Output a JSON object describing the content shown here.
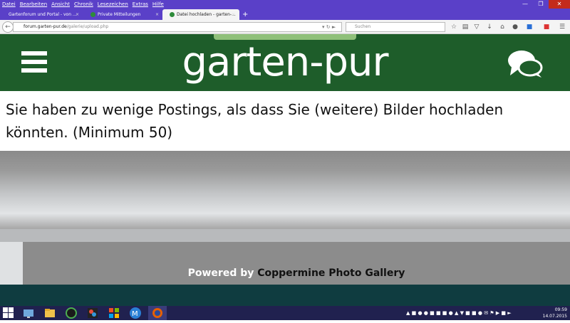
{
  "menu": [
    "Datei",
    "Bearbeiten",
    "Ansicht",
    "Chronik",
    "Lesezeichen",
    "Extras",
    "Hilfe"
  ],
  "tabs": [
    {
      "label": "Gartenforum und Portal - von ..."
    },
    {
      "label": "Private Mitteilungen"
    },
    {
      "label": "Datei hochladen - garten-..."
    }
  ],
  "new_tab_symbol": "+",
  "address": {
    "host": "forum.garten-pur.de",
    "path": "/galerie/upload.php",
    "full": "forum.garten-pur.de/galerie/upload.php"
  },
  "search_placeholder": "Suchen",
  "site": {
    "logo": "garten-pur"
  },
  "message": "Sie haben zu wenige Postings, als dass Sie (weitere) Bilder hochladen könnten. (Minimum 50)",
  "footer": {
    "powered_by": "Powered by",
    "link": "Coppermine Photo Gallery"
  },
  "clock": {
    "time": "09:59",
    "date": "14.07.2015"
  },
  "colors": {
    "titlebar": "#5a40c8",
    "header": "#1e5d2a",
    "taskbar": "#20214f"
  }
}
